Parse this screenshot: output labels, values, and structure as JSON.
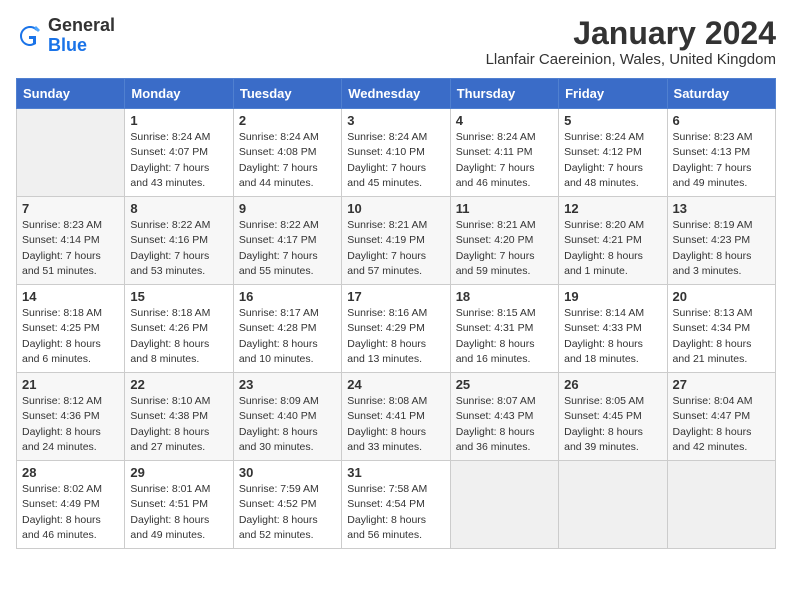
{
  "header": {
    "logo_general": "General",
    "logo_blue": "Blue",
    "title": "January 2024",
    "subtitle": "Llanfair Caereinion, Wales, United Kingdom"
  },
  "days_of_week": [
    "Sunday",
    "Monday",
    "Tuesday",
    "Wednesday",
    "Thursday",
    "Friday",
    "Saturday"
  ],
  "weeks": [
    [
      {
        "day": "",
        "info": ""
      },
      {
        "day": "1",
        "info": "Sunrise: 8:24 AM\nSunset: 4:07 PM\nDaylight: 7 hours\nand 43 minutes."
      },
      {
        "day": "2",
        "info": "Sunrise: 8:24 AM\nSunset: 4:08 PM\nDaylight: 7 hours\nand 44 minutes."
      },
      {
        "day": "3",
        "info": "Sunrise: 8:24 AM\nSunset: 4:10 PM\nDaylight: 7 hours\nand 45 minutes."
      },
      {
        "day": "4",
        "info": "Sunrise: 8:24 AM\nSunset: 4:11 PM\nDaylight: 7 hours\nand 46 minutes."
      },
      {
        "day": "5",
        "info": "Sunrise: 8:24 AM\nSunset: 4:12 PM\nDaylight: 7 hours\nand 48 minutes."
      },
      {
        "day": "6",
        "info": "Sunrise: 8:23 AM\nSunset: 4:13 PM\nDaylight: 7 hours\nand 49 minutes."
      }
    ],
    [
      {
        "day": "7",
        "info": "Sunrise: 8:23 AM\nSunset: 4:14 PM\nDaylight: 7 hours\nand 51 minutes."
      },
      {
        "day": "8",
        "info": "Sunrise: 8:22 AM\nSunset: 4:16 PM\nDaylight: 7 hours\nand 53 minutes."
      },
      {
        "day": "9",
        "info": "Sunrise: 8:22 AM\nSunset: 4:17 PM\nDaylight: 7 hours\nand 55 minutes."
      },
      {
        "day": "10",
        "info": "Sunrise: 8:21 AM\nSunset: 4:19 PM\nDaylight: 7 hours\nand 57 minutes."
      },
      {
        "day": "11",
        "info": "Sunrise: 8:21 AM\nSunset: 4:20 PM\nDaylight: 7 hours\nand 59 minutes."
      },
      {
        "day": "12",
        "info": "Sunrise: 8:20 AM\nSunset: 4:21 PM\nDaylight: 8 hours\nand 1 minute."
      },
      {
        "day": "13",
        "info": "Sunrise: 8:19 AM\nSunset: 4:23 PM\nDaylight: 8 hours\nand 3 minutes."
      }
    ],
    [
      {
        "day": "14",
        "info": "Sunrise: 8:18 AM\nSunset: 4:25 PM\nDaylight: 8 hours\nand 6 minutes."
      },
      {
        "day": "15",
        "info": "Sunrise: 8:18 AM\nSunset: 4:26 PM\nDaylight: 8 hours\nand 8 minutes."
      },
      {
        "day": "16",
        "info": "Sunrise: 8:17 AM\nSunset: 4:28 PM\nDaylight: 8 hours\nand 10 minutes."
      },
      {
        "day": "17",
        "info": "Sunrise: 8:16 AM\nSunset: 4:29 PM\nDaylight: 8 hours\nand 13 minutes."
      },
      {
        "day": "18",
        "info": "Sunrise: 8:15 AM\nSunset: 4:31 PM\nDaylight: 8 hours\nand 16 minutes."
      },
      {
        "day": "19",
        "info": "Sunrise: 8:14 AM\nSunset: 4:33 PM\nDaylight: 8 hours\nand 18 minutes."
      },
      {
        "day": "20",
        "info": "Sunrise: 8:13 AM\nSunset: 4:34 PM\nDaylight: 8 hours\nand 21 minutes."
      }
    ],
    [
      {
        "day": "21",
        "info": "Sunrise: 8:12 AM\nSunset: 4:36 PM\nDaylight: 8 hours\nand 24 minutes."
      },
      {
        "day": "22",
        "info": "Sunrise: 8:10 AM\nSunset: 4:38 PM\nDaylight: 8 hours\nand 27 minutes."
      },
      {
        "day": "23",
        "info": "Sunrise: 8:09 AM\nSunset: 4:40 PM\nDaylight: 8 hours\nand 30 minutes."
      },
      {
        "day": "24",
        "info": "Sunrise: 8:08 AM\nSunset: 4:41 PM\nDaylight: 8 hours\nand 33 minutes."
      },
      {
        "day": "25",
        "info": "Sunrise: 8:07 AM\nSunset: 4:43 PM\nDaylight: 8 hours\nand 36 minutes."
      },
      {
        "day": "26",
        "info": "Sunrise: 8:05 AM\nSunset: 4:45 PM\nDaylight: 8 hours\nand 39 minutes."
      },
      {
        "day": "27",
        "info": "Sunrise: 8:04 AM\nSunset: 4:47 PM\nDaylight: 8 hours\nand 42 minutes."
      }
    ],
    [
      {
        "day": "28",
        "info": "Sunrise: 8:02 AM\nSunset: 4:49 PM\nDaylight: 8 hours\nand 46 minutes."
      },
      {
        "day": "29",
        "info": "Sunrise: 8:01 AM\nSunset: 4:51 PM\nDaylight: 8 hours\nand 49 minutes."
      },
      {
        "day": "30",
        "info": "Sunrise: 7:59 AM\nSunset: 4:52 PM\nDaylight: 8 hours\nand 52 minutes."
      },
      {
        "day": "31",
        "info": "Sunrise: 7:58 AM\nSunset: 4:54 PM\nDaylight: 8 hours\nand 56 minutes."
      },
      {
        "day": "",
        "info": ""
      },
      {
        "day": "",
        "info": ""
      },
      {
        "day": "",
        "info": ""
      }
    ]
  ]
}
